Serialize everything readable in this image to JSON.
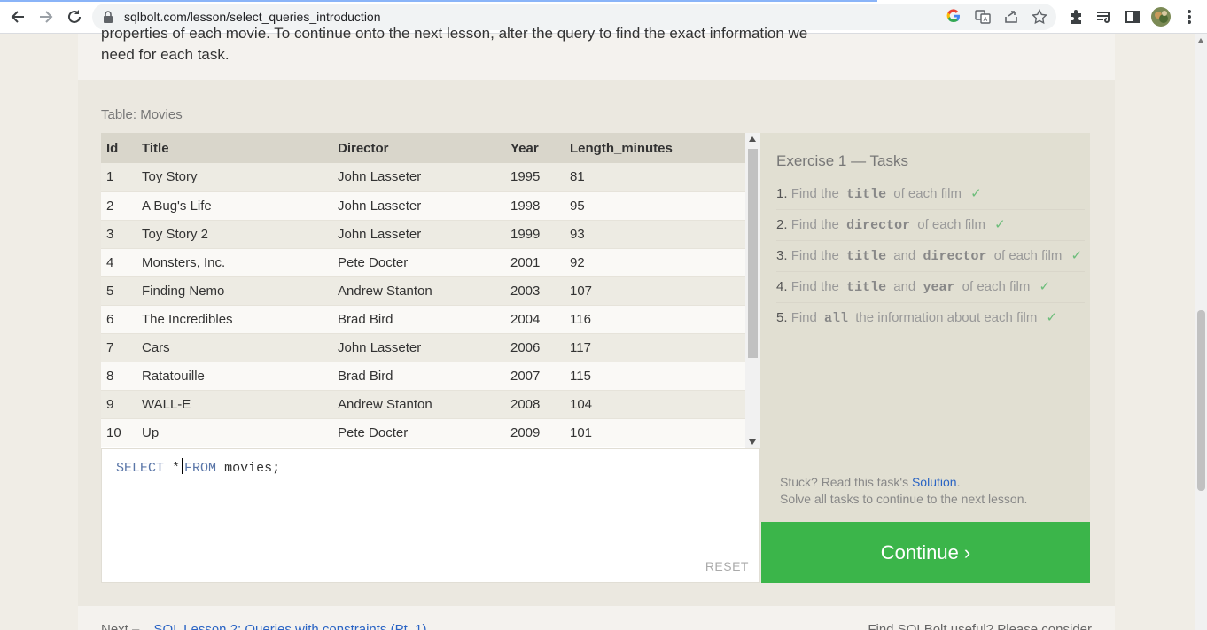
{
  "browser": {
    "url": "sqlbolt.com/lesson/select_queries_introduction",
    "icons": [
      "back-icon",
      "forward-icon",
      "reload-icon",
      "lock-icon",
      "google-icon",
      "translate-icon",
      "share-icon",
      "star-icon",
      "extensions-icon",
      "media-icon",
      "sidepanel-icon",
      "avatar",
      "menu-icon"
    ]
  },
  "intro": {
    "line1": "properties of each movie. To continue onto the next lesson, alter the query to find the exact information we",
    "line2": "need for each task."
  },
  "table": {
    "label": "Table: Movies",
    "columns": [
      "Id",
      "Title",
      "Director",
      "Year",
      "Length_minutes"
    ],
    "rows": [
      [
        "1",
        "Toy Story",
        "John Lasseter",
        "1995",
        "81"
      ],
      [
        "2",
        "A Bug's Life",
        "John Lasseter",
        "1998",
        "95"
      ],
      [
        "3",
        "Toy Story 2",
        "John Lasseter",
        "1999",
        "93"
      ],
      [
        "4",
        "Monsters, Inc.",
        "Pete Docter",
        "2001",
        "92"
      ],
      [
        "5",
        "Finding Nemo",
        "Andrew Stanton",
        "2003",
        "107"
      ],
      [
        "6",
        "The Incredibles",
        "Brad Bird",
        "2004",
        "116"
      ],
      [
        "7",
        "Cars",
        "John Lasseter",
        "2006",
        "117"
      ],
      [
        "8",
        "Ratatouille",
        "Brad Bird",
        "2007",
        "115"
      ],
      [
        "9",
        "WALL-E",
        "Andrew Stanton",
        "2008",
        "104"
      ],
      [
        "10",
        "Up",
        "Pete Docter",
        "2009",
        "101"
      ]
    ]
  },
  "editor": {
    "kw1": "SELECT",
    "star": "*",
    "kw2": "FROM",
    "rest": "movies;",
    "reset_label": "RESET"
  },
  "tasks": {
    "heading": "Exercise 1 — Tasks",
    "check": "✓",
    "t1": {
      "num": "1.",
      "a": "Find the",
      "c1": "title",
      "b": "of each film"
    },
    "t2": {
      "num": "2.",
      "a": "Find the",
      "c1": "director",
      "b": "of each film"
    },
    "t3": {
      "num": "3.",
      "a": "Find the",
      "c1": "title",
      "and": "and",
      "c2": "director",
      "b": "of each film"
    },
    "t4": {
      "num": "4.",
      "a": "Find the",
      "c1": "title",
      "and": "and",
      "c2": "year",
      "b": "of each film"
    },
    "t5": {
      "num": "5.",
      "a": "Find",
      "c1": "all",
      "b": "the information about each film"
    },
    "stuck_text": "Stuck? Read this task's",
    "solution_link": "Solution",
    "stuck_end": ".",
    "solve_all": "Solve all tasks to continue to the next lesson."
  },
  "continue_label": "Continue ›",
  "footer": {
    "next_label": "Next –",
    "next_link": "SQL Lesson 2: Queries with constraints (Pt. 1)",
    "right_text": "Find SQLBolt useful? Please consider"
  },
  "colors": {
    "continue_green": "#3bb54a",
    "link_blue": "#2a64c4",
    "check_green": "#6cbd7a"
  }
}
